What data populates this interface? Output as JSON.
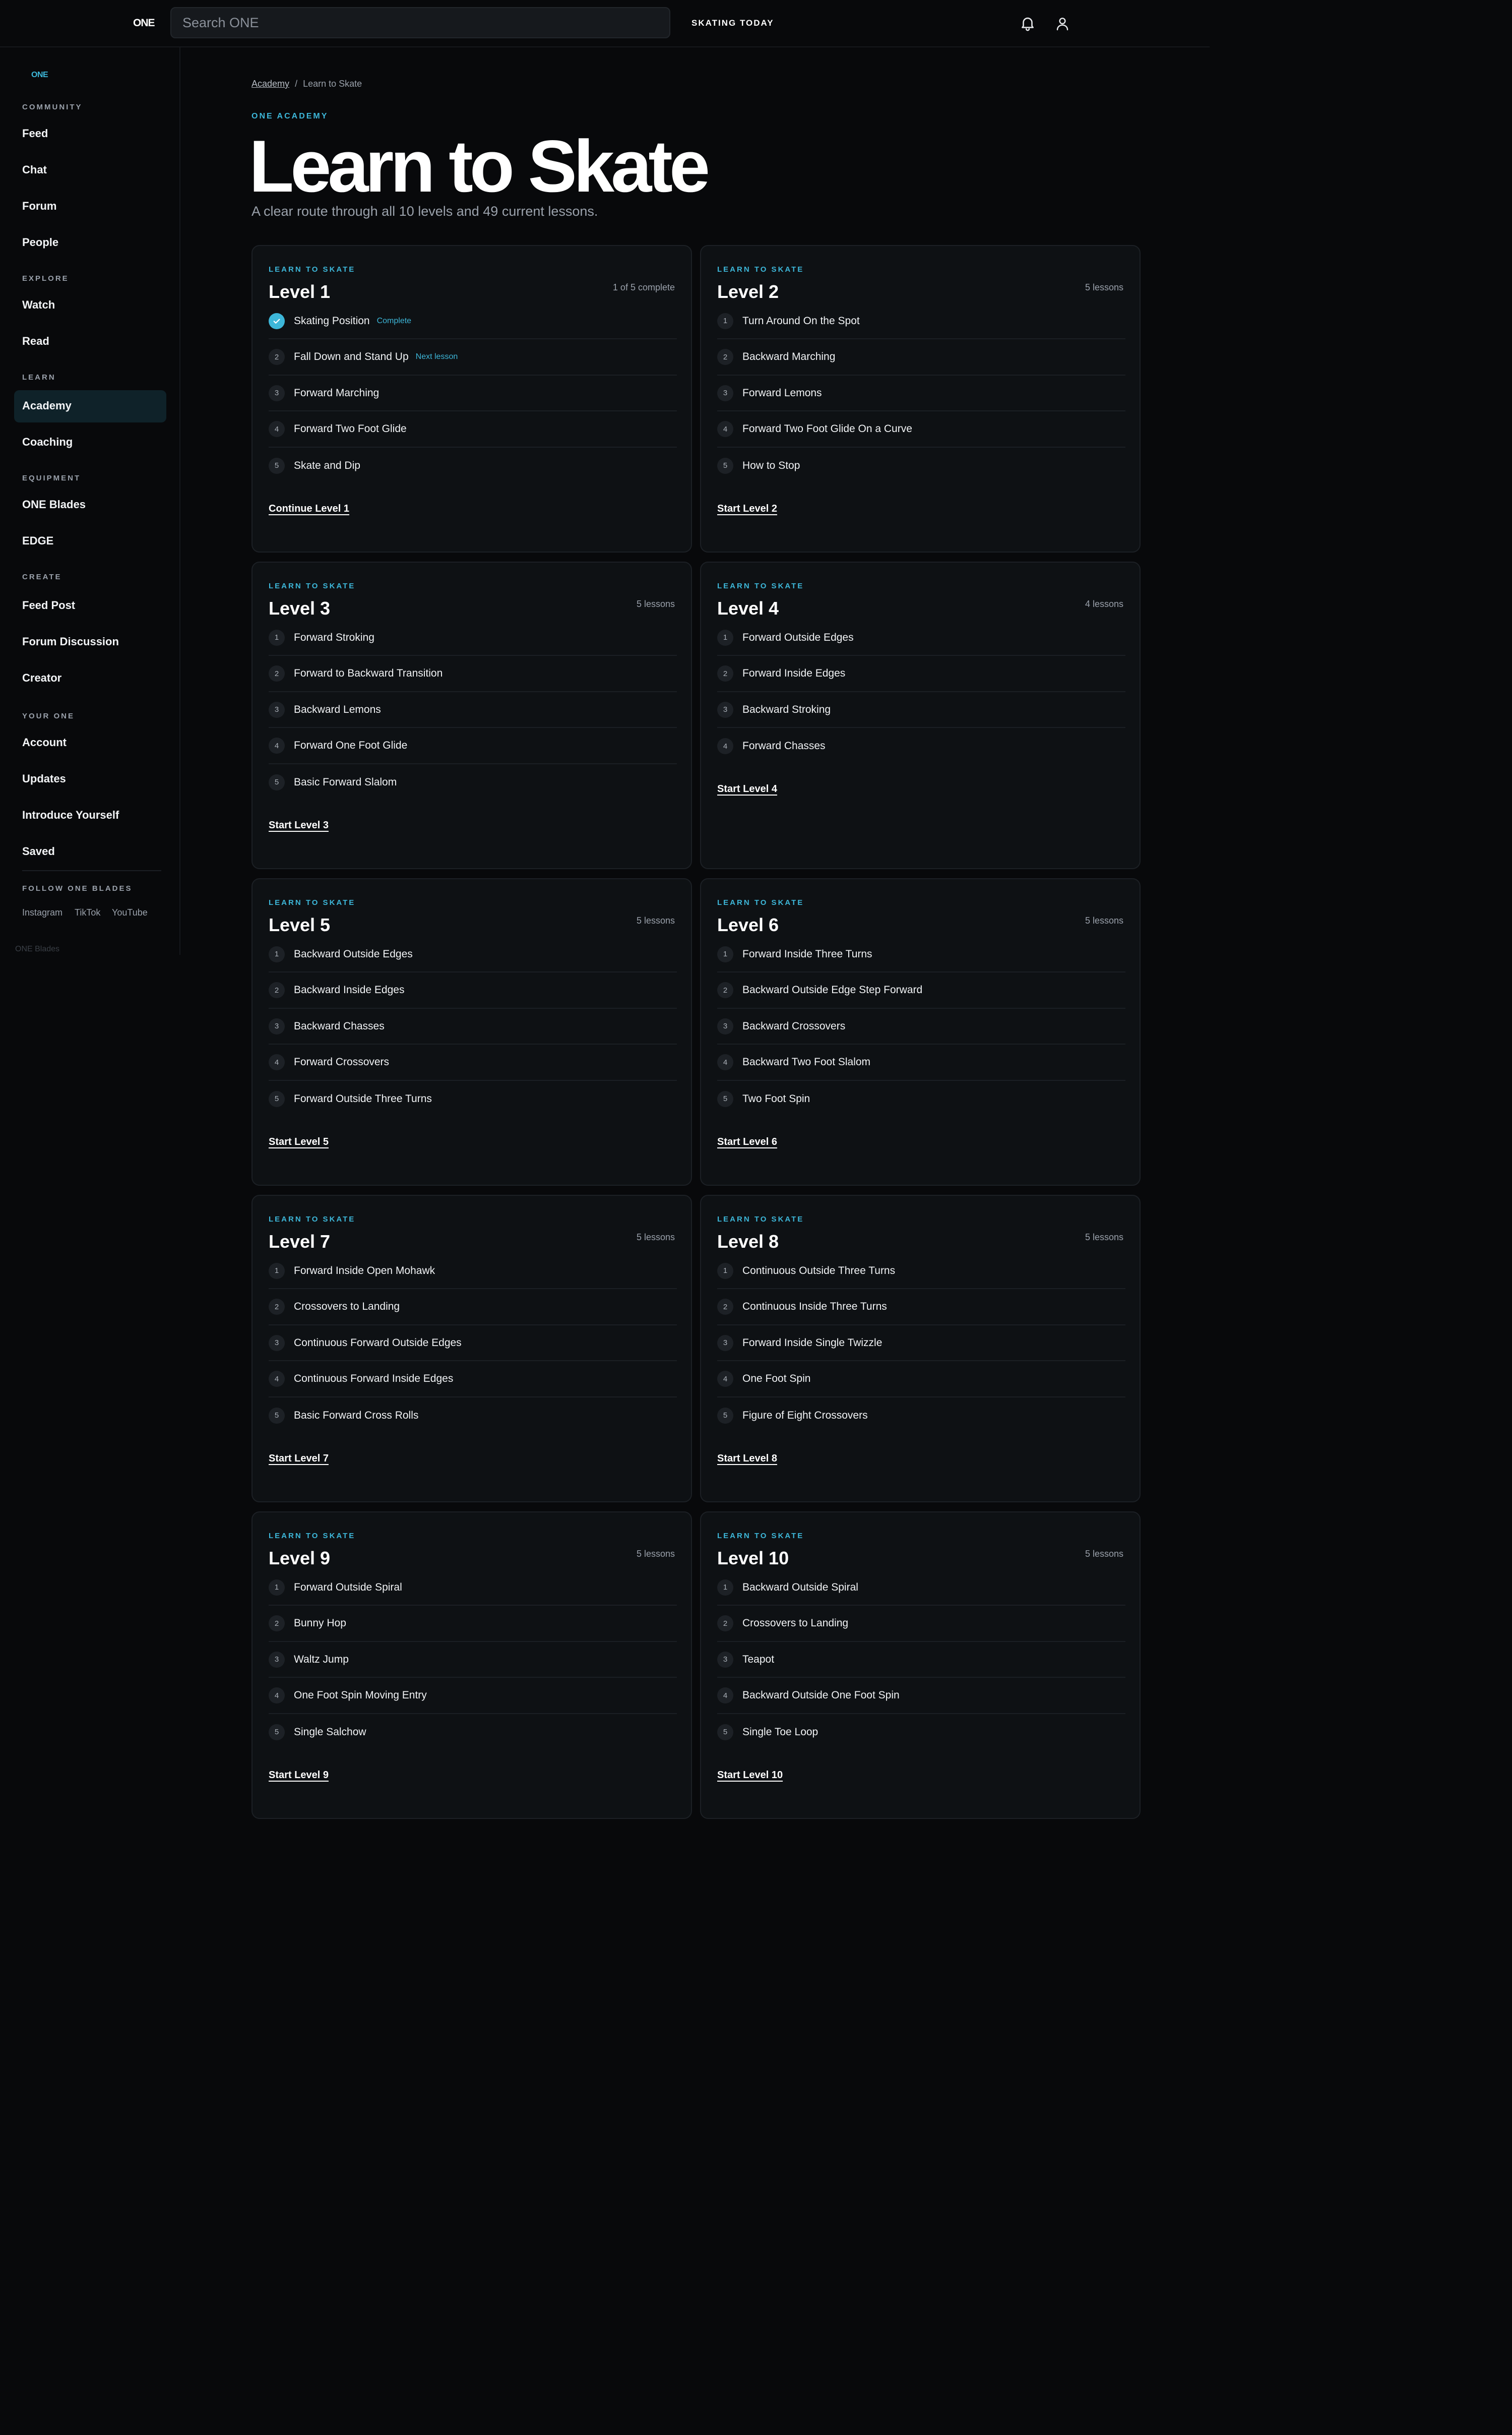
{
  "topbar": {
    "logo": "ONE",
    "search_placeholder": "Search ONE",
    "skating_today": "SKATING TODAY",
    "icons": [
      "bell-icon",
      "user-icon"
    ]
  },
  "sidebar": {
    "logo": "ONE",
    "sections": [
      {
        "label": "COMMUNITY",
        "items": [
          "Feed",
          "Chat",
          "Forum",
          "People"
        ]
      },
      {
        "label": "EXPLORE",
        "items": [
          "Watch",
          "Read"
        ]
      },
      {
        "label": "LEARN",
        "items": [
          "Academy",
          "Coaching"
        ]
      },
      {
        "label": "EQUIPMENT",
        "items": [
          "ONE Blades",
          "EDGE"
        ]
      },
      {
        "label": "CREATE",
        "items": [
          "Feed Post",
          "Forum Discussion",
          "Creator"
        ]
      },
      {
        "label": "YOUR ONE",
        "items": [
          "Account",
          "Updates",
          "Introduce Yourself",
          "Saved"
        ]
      }
    ],
    "active_item": "Academy",
    "follow_label": "FOLLOW ONE BLADES",
    "social": [
      "Instagram",
      "TikTok",
      "YouTube"
    ],
    "footer_fragment": "ONE Blades"
  },
  "breadcrumb": {
    "parent": "Academy",
    "separator": "/",
    "current": "Learn to Skate"
  },
  "header": {
    "kicker": "ONE ACADEMY",
    "title": "Learn to Skate",
    "subtitle": "A clear route through all 10 levels and 49 current lessons."
  },
  "colors": {
    "accent": "#3db7d9",
    "background": "#08090b",
    "card": "#0e1114"
  },
  "levels": [
    {
      "kicker": "LEARN TO SKATE",
      "title": "Level 1",
      "meta": "1 of 5 complete",
      "lessons": [
        {
          "num": "1",
          "name": "Skating Position",
          "tag": "Complete",
          "done": true
        },
        {
          "num": "2",
          "name": "Fall Down and Stand Up",
          "tag": "Next lesson"
        },
        {
          "num": "3",
          "name": "Forward Marching"
        },
        {
          "num": "4",
          "name": "Forward Two Foot Glide"
        },
        {
          "num": "5",
          "name": "Skate and Dip"
        }
      ],
      "action": "Continue Level 1"
    },
    {
      "kicker": "LEARN TO SKATE",
      "title": "Level 2",
      "meta": "5 lessons",
      "lessons": [
        {
          "num": "1",
          "name": "Turn Around On the Spot"
        },
        {
          "num": "2",
          "name": "Backward Marching"
        },
        {
          "num": "3",
          "name": "Forward Lemons"
        },
        {
          "num": "4",
          "name": "Forward Two Foot Glide On a Curve"
        },
        {
          "num": "5",
          "name": "How to Stop"
        }
      ],
      "action": "Start Level 2"
    },
    {
      "kicker": "LEARN TO SKATE",
      "title": "Level 3",
      "meta": "5 lessons",
      "lessons": [
        {
          "num": "1",
          "name": "Forward Stroking"
        },
        {
          "num": "2",
          "name": "Forward to Backward Transition"
        },
        {
          "num": "3",
          "name": "Backward Lemons"
        },
        {
          "num": "4",
          "name": "Forward One Foot Glide"
        },
        {
          "num": "5",
          "name": "Basic Forward Slalom"
        }
      ],
      "action": "Start Level 3"
    },
    {
      "kicker": "LEARN TO SKATE",
      "title": "Level 4",
      "meta": "4 lessons",
      "lessons": [
        {
          "num": "1",
          "name": "Forward Outside Edges"
        },
        {
          "num": "2",
          "name": "Forward Inside Edges"
        },
        {
          "num": "3",
          "name": "Backward Stroking"
        },
        {
          "num": "4",
          "name": "Forward Chasses"
        }
      ],
      "action": "Start Level 4"
    },
    {
      "kicker": "LEARN TO SKATE",
      "title": "Level 5",
      "meta": "5 lessons",
      "lessons": [
        {
          "num": "1",
          "name": "Backward Outside Edges"
        },
        {
          "num": "2",
          "name": "Backward Inside Edges"
        },
        {
          "num": "3",
          "name": "Backward Chasses"
        },
        {
          "num": "4",
          "name": "Forward Crossovers"
        },
        {
          "num": "5",
          "name": "Forward Outside Three Turns"
        }
      ],
      "action": "Start Level 5"
    },
    {
      "kicker": "LEARN TO SKATE",
      "title": "Level 6",
      "meta": "5 lessons",
      "lessons": [
        {
          "num": "1",
          "name": "Forward Inside Three Turns"
        },
        {
          "num": "2",
          "name": "Backward Outside Edge Step Forward"
        },
        {
          "num": "3",
          "name": "Backward Crossovers"
        },
        {
          "num": "4",
          "name": "Backward Two Foot Slalom"
        },
        {
          "num": "5",
          "name": "Two Foot Spin"
        }
      ],
      "action": "Start Level 6"
    },
    {
      "kicker": "LEARN TO SKATE",
      "title": "Level 7",
      "meta": "5 lessons",
      "lessons": [
        {
          "num": "1",
          "name": "Forward Inside Open Mohawk"
        },
        {
          "num": "2",
          "name": "Crossovers to Landing"
        },
        {
          "num": "3",
          "name": "Continuous Forward Outside Edges"
        },
        {
          "num": "4",
          "name": "Continuous Forward Inside Edges"
        },
        {
          "num": "5",
          "name": "Basic Forward Cross Rolls"
        }
      ],
      "action": "Start Level 7"
    },
    {
      "kicker": "LEARN TO SKATE",
      "title": "Level 8",
      "meta": "5 lessons",
      "lessons": [
        {
          "num": "1",
          "name": "Continuous Outside Three Turns"
        },
        {
          "num": "2",
          "name": "Continuous Inside Three Turns"
        },
        {
          "num": "3",
          "name": "Forward Inside Single Twizzle"
        },
        {
          "num": "4",
          "name": "One Foot Spin"
        },
        {
          "num": "5",
          "name": "Figure of Eight Crossovers"
        }
      ],
      "action": "Start Level 8"
    },
    {
      "kicker": "LEARN TO SKATE",
      "title": "Level 9",
      "meta": "5 lessons",
      "lessons": [
        {
          "num": "1",
          "name": "Forward Outside Spiral"
        },
        {
          "num": "2",
          "name": "Bunny Hop"
        },
        {
          "num": "3",
          "name": "Waltz Jump"
        },
        {
          "num": "4",
          "name": "One Foot Spin Moving Entry"
        },
        {
          "num": "5",
          "name": "Single Salchow"
        }
      ],
      "action": "Start Level 9"
    },
    {
      "kicker": "LEARN TO SKATE",
      "title": "Level 10",
      "meta": "5 lessons",
      "lessons": [
        {
          "num": "1",
          "name": "Backward Outside Spiral"
        },
        {
          "num": "2",
          "name": "Crossovers to Landing"
        },
        {
          "num": "3",
          "name": "Teapot"
        },
        {
          "num": "4",
          "name": "Backward Outside One Foot Spin"
        },
        {
          "num": "5",
          "name": "Single Toe Loop"
        }
      ],
      "action": "Start Level 10"
    }
  ]
}
